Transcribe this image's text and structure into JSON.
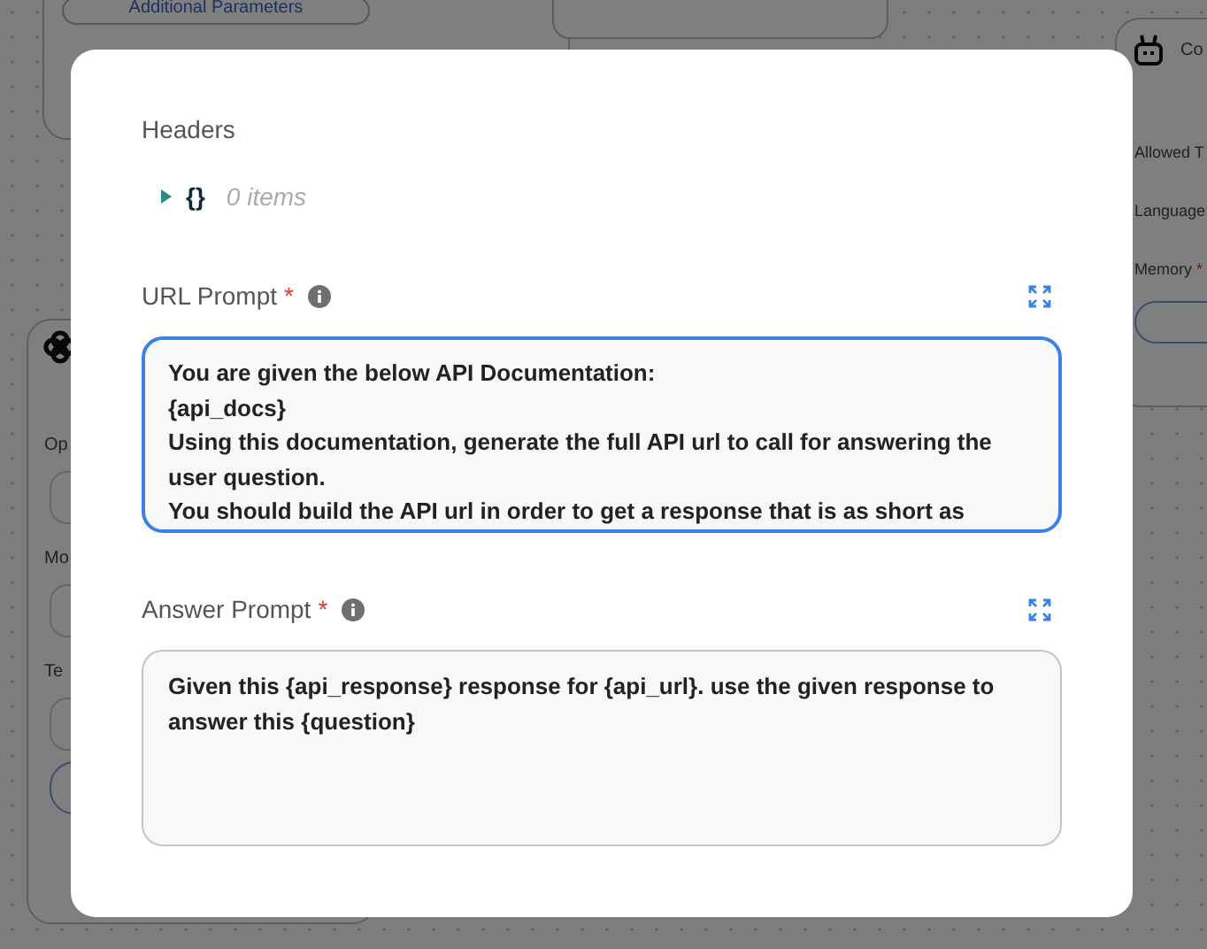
{
  "canvas": {
    "top_left_node": {
      "button": "Additional Parameters"
    },
    "left_node": {
      "fields": [
        {
          "label": "Op"
        },
        {
          "label": "Mo"
        },
        {
          "label": "Te"
        }
      ]
    },
    "right_node": {
      "title": "Co",
      "fields": [
        {
          "label": "Allowed T"
        },
        {
          "label": "Language"
        },
        {
          "label": "Memory",
          "required_mark": "*"
        }
      ]
    }
  },
  "dialog": {
    "headers": {
      "label": "Headers",
      "expanded": false,
      "braces": "{}",
      "count": "0 items"
    },
    "fields": [
      {
        "label": "URL Prompt",
        "required_mark": "*",
        "focused": true,
        "lines": [
          "You are given the below API Documentation:",
          "{api_docs}",
          "Using this documentation, generate the full API url to call for answering the",
          "user question.",
          "You should build the API url in order to get a response that is as short as"
        ]
      },
      {
        "label": "Answer Prompt",
        "required_mark": "*",
        "focused": false,
        "lines": [
          "Given this {api_response} response for {api_url}. use the given response to",
          "answer this {question}"
        ]
      }
    ]
  }
}
